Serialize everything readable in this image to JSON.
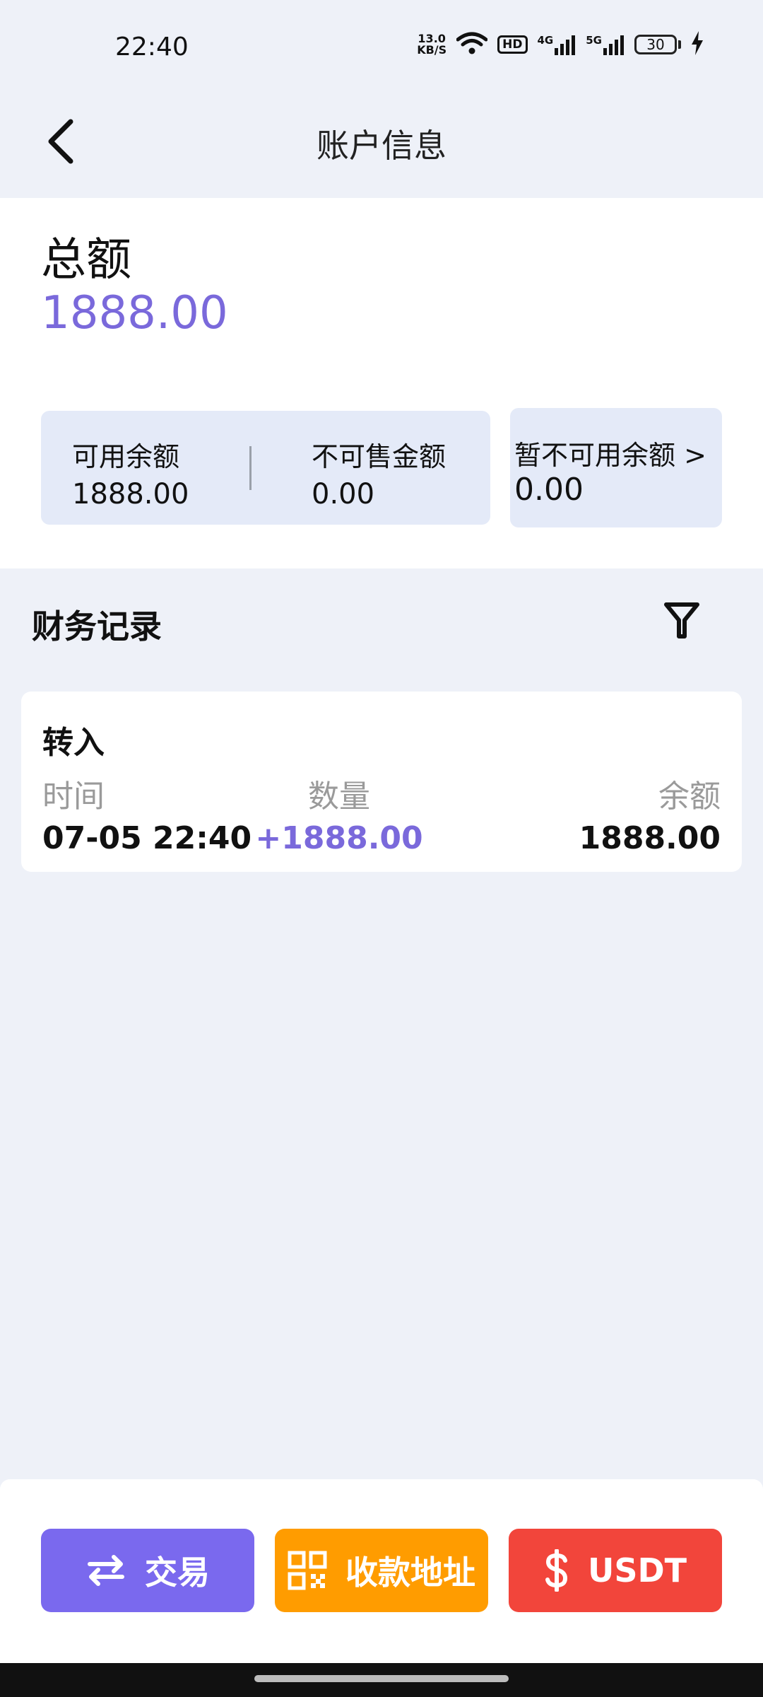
{
  "status_bar": {
    "time": "22:40",
    "net_speed_value": "13.0",
    "net_speed_unit": "KB/S",
    "hd_badge": "HD",
    "net_4g": "4G",
    "net_5g": "5G",
    "battery": "30",
    "icons": [
      "wifi-icon",
      "signal-4g-icon",
      "signal-5g-icon",
      "battery-icon",
      "charging-icon"
    ]
  },
  "header": {
    "title": "账户信息",
    "back_icon": "chevron-left-icon"
  },
  "summary": {
    "total_label": "总额",
    "total_value": "1888.00",
    "available_label": "可用余额",
    "available_value": "1888.00",
    "unsellable_label": "不可售金额",
    "unsellable_value": "0.00",
    "unavailable_label": "暂不可用余额 >",
    "unavailable_value": "0.00"
  },
  "records": {
    "title": "财务记录",
    "filter_icon": "filter-icon",
    "items": [
      {
        "type": "转入",
        "time_label": "时间",
        "time_value": "07-05 22:40",
        "qty_label": "数量",
        "qty_value": "+1888.00",
        "balance_label": "余额",
        "balance_value": "1888.00"
      }
    ]
  },
  "actions": {
    "trade_label": "交易",
    "address_label": "收款地址",
    "usdt_label": "USDT",
    "colors": {
      "trade": "#7a69ee",
      "address": "#ff9c00",
      "usdt": "#f2453b"
    }
  },
  "colors": {
    "accent": "#7a69db",
    "background": "#eef1f8",
    "balance_box": "#e4eaf8"
  }
}
